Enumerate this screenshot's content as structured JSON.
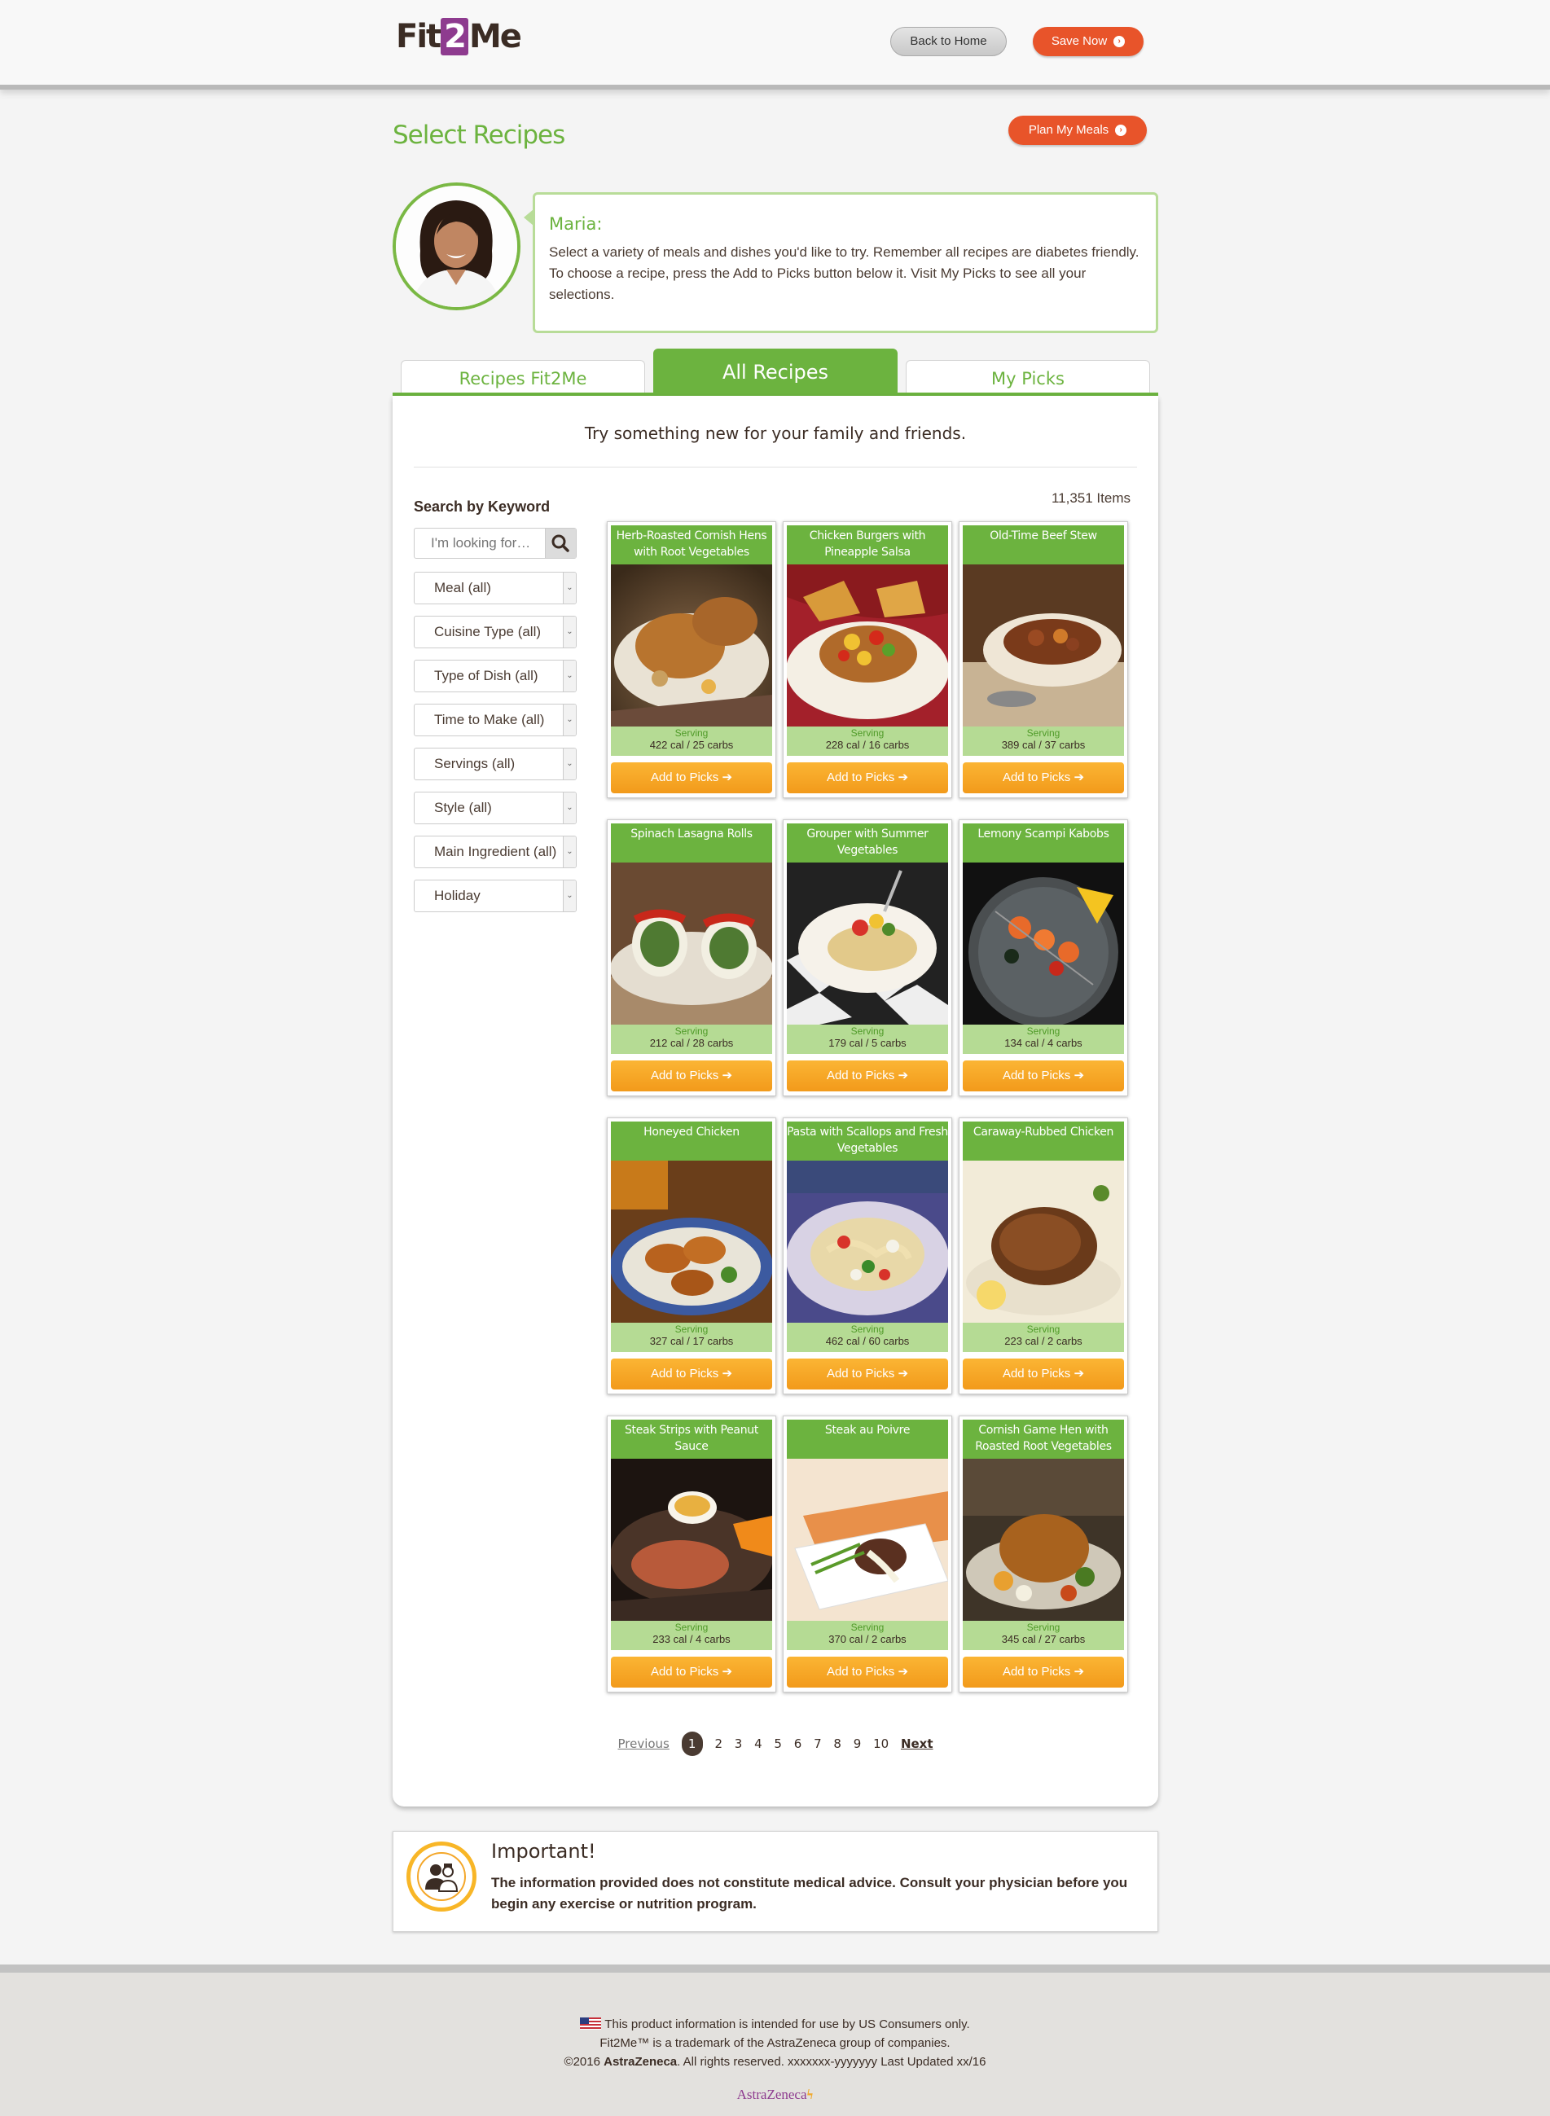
{
  "header": {
    "logo_prefix": "Fit",
    "logo_two": "2",
    "logo_suffix": "Me",
    "back_home": "Back to Home",
    "save_now": "Save Now"
  },
  "page": {
    "title": "Select Recipes",
    "plan_button": "Plan My Meals"
  },
  "coach": {
    "name": "Maria:",
    "message": "Select a variety of meals and dishes you'd like to try. Remember all recipes are diabetes friendly. To choose a recipe, press the Add to Picks button below it. Visit My Picks to see all your selections."
  },
  "tabs": [
    {
      "label": "Recipes Fit2Me"
    },
    {
      "label": "All Recipes"
    },
    {
      "label": "My Picks"
    }
  ],
  "main": {
    "tagline": "Try something new for your family and friends.",
    "item_count": "11,351 Items"
  },
  "filters": {
    "search_label": "Search by Keyword",
    "search_placeholder": "I'm looking for…",
    "selects": [
      {
        "value": "Meal (all)"
      },
      {
        "value": "Cuisine Type (all)"
      },
      {
        "value": "Type of Dish (all)"
      },
      {
        "value": "Time to Make (all)"
      },
      {
        "value": "Servings (all)"
      },
      {
        "value": "Style (all)"
      },
      {
        "value": "Main Ingredient (all)"
      },
      {
        "value": "Holiday"
      }
    ]
  },
  "recipes": [
    {
      "title": "Herb-Roasted Cornish Hens with Root Vegetables",
      "serving": "Serving",
      "nutrition": "422 cal / 25 carbs",
      "button": "Add to Picks"
    },
    {
      "title": "Chicken Burgers with Pineapple Salsa",
      "serving": "Serving",
      "nutrition": "228 cal / 16 carbs",
      "button": "Add to Picks"
    },
    {
      "title": "Old-Time Beef Stew",
      "serving": "Serving",
      "nutrition": "389 cal / 37 carbs",
      "button": "Add to Picks"
    },
    {
      "title": "Spinach Lasagna Rolls",
      "serving": "Serving",
      "nutrition": "212 cal / 28 carbs",
      "button": "Add to Picks"
    },
    {
      "title": "Grouper with Summer Vegetables",
      "serving": "Serving",
      "nutrition": "179 cal / 5 carbs",
      "button": "Add to Picks"
    },
    {
      "title": "Lemony Scampi Kabobs",
      "serving": "Serving",
      "nutrition": "134 cal / 4 carbs",
      "button": "Add to Picks"
    },
    {
      "title": "Honeyed Chicken",
      "serving": "Serving",
      "nutrition": "327 cal / 17 carbs",
      "button": "Add to Picks"
    },
    {
      "title": "Pasta with Scallops and Fresh Vegetables",
      "serving": "Serving",
      "nutrition": "462 cal / 60 carbs",
      "button": "Add to Picks"
    },
    {
      "title": "Caraway-Rubbed Chicken",
      "serving": "Serving",
      "nutrition": "223 cal / 2 carbs",
      "button": "Add to Picks"
    },
    {
      "title": "Steak Strips with Peanut Sauce",
      "serving": "Serving",
      "nutrition": "233 cal / 4 carbs",
      "button": "Add to Picks"
    },
    {
      "title": "Steak au Poivre",
      "serving": "Serving",
      "nutrition": "370 cal / 2 carbs",
      "button": "Add to Picks"
    },
    {
      "title": "Cornish Game Hen with Roasted Root Vegetables",
      "serving": "Serving",
      "nutrition": "345 cal / 27 carbs",
      "button": "Add to Picks"
    }
  ],
  "pagination": {
    "previous": "Previous",
    "pages": [
      "1",
      "2",
      "3",
      "4",
      "5",
      "6",
      "7",
      "8",
      "9",
      "10"
    ],
    "current": "1",
    "next": "Next"
  },
  "important": {
    "title": "Important!",
    "text": "The information provided does not constitute medical advice. Consult your physician before you begin any exercise or nutrition program."
  },
  "footer": {
    "line1": "This product information is intended for use by US Consumers only.",
    "line2": "Fit2Me™ is a trademark of the AstraZeneca group of companies.",
    "line3_prefix": "©2016 ",
    "line3_brand": "AstraZeneca",
    "line3_suffix": ". All rights reserved. xxxxxxx-yyyyyyy Last Updated xx/16",
    "brand_logo": "AstraZeneca"
  },
  "colors": {
    "green": "#6cb33f",
    "orange_button": "#f29a1b",
    "red_button": "#e8542a",
    "brown_text": "#3b2c24",
    "logo_purple": "#8e3b8f"
  }
}
